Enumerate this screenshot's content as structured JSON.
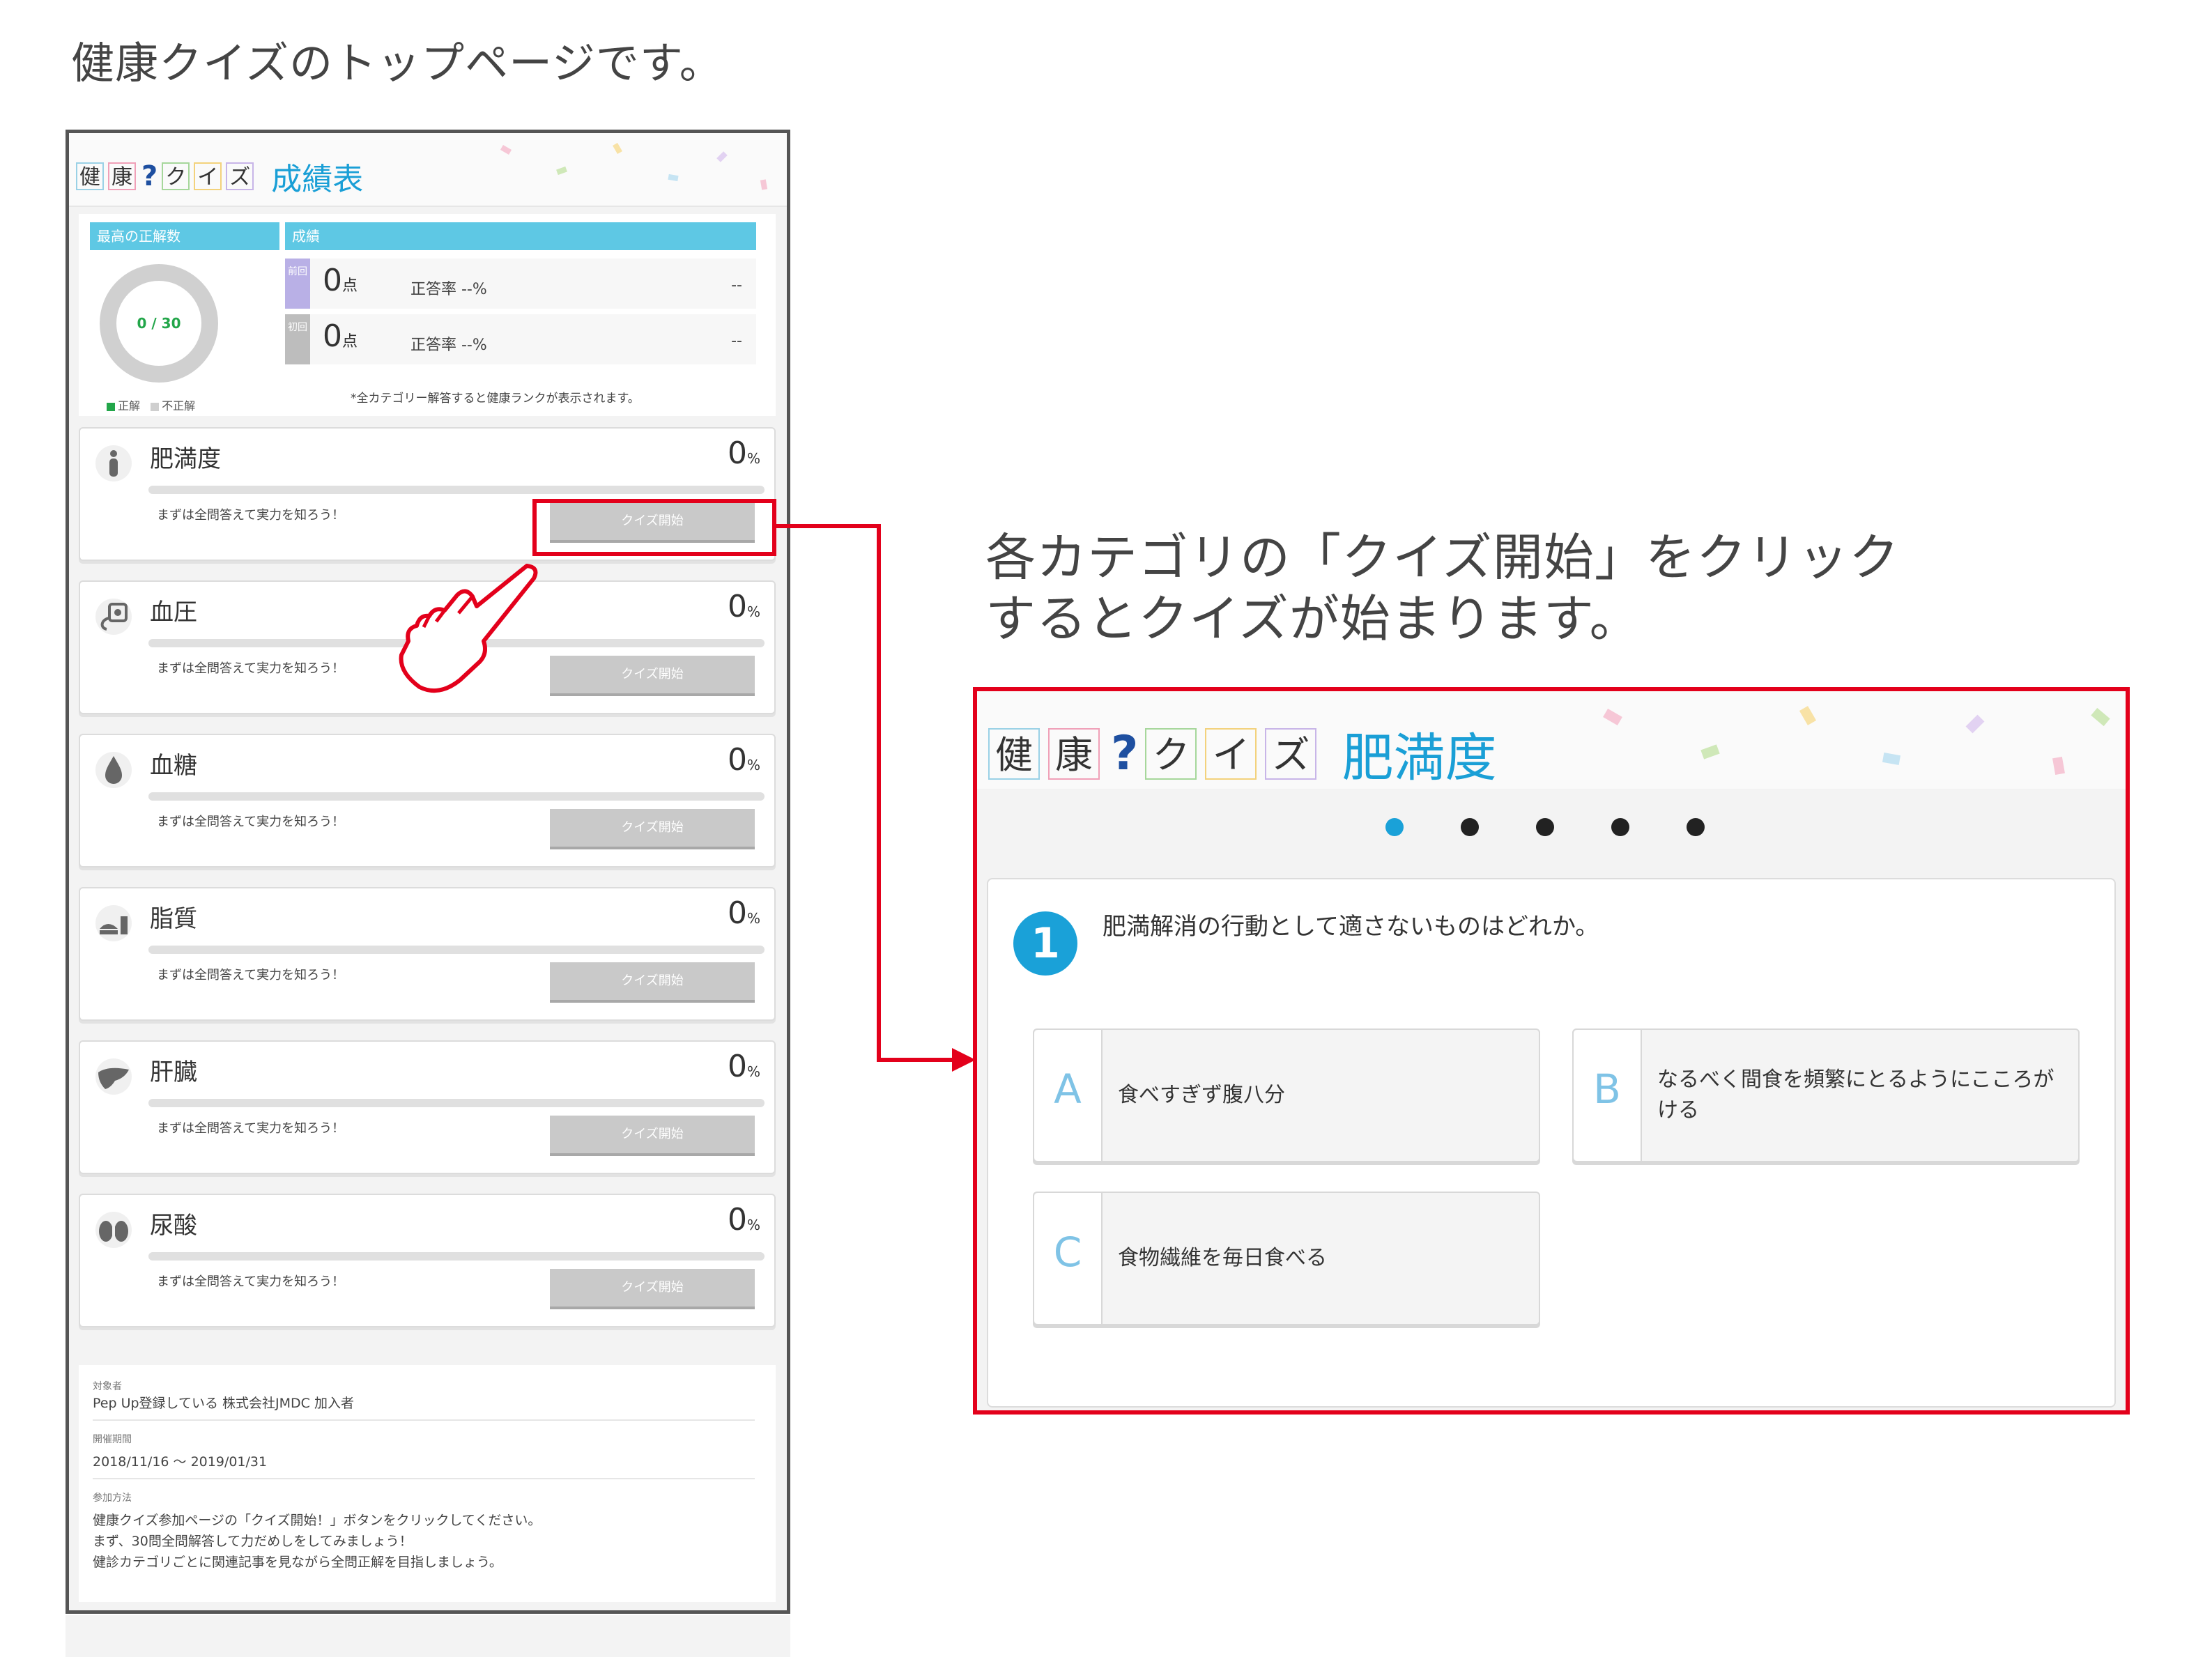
{
  "captions": {
    "top": "健康クイズのトップページです。",
    "right_line1": "各カテゴリの「クイズ開始」をクリック",
    "right_line2": "するとクイズが始まります。"
  },
  "logo": {
    "chars": [
      "健",
      "康",
      "?",
      "ク",
      "イ",
      "ズ"
    ]
  },
  "top_page": {
    "title": "成績表",
    "summary": {
      "best_label": "最高の正解数",
      "score_label": "成績",
      "donut_text": "0 / 30",
      "legend_correct": "正解",
      "legend_incorrect": "不正解",
      "rows": [
        {
          "tag": "前回",
          "score": "0",
          "unit": "点",
          "rate": "正答率 --%",
          "right": "--"
        },
        {
          "tag": "初回",
          "score": "0",
          "unit": "点",
          "rate": "正答率 --%",
          "right": "--"
        }
      ],
      "note": "*全カテゴリー解答すると健康ランクが表示されます。"
    },
    "categories": [
      {
        "name": "肥満度",
        "pct": "0",
        "unit": "%",
        "msg": "まずは全問答えて実力を知ろう！",
        "button": "クイズ開始",
        "icon": "body-icon"
      },
      {
        "name": "血圧",
        "pct": "0",
        "unit": "%",
        "msg": "まずは全問答えて実力を知ろう！",
        "button": "クイズ開始",
        "icon": "blood-pressure-icon"
      },
      {
        "name": "血糖",
        "pct": "0",
        "unit": "%",
        "msg": "まずは全問答えて実力を知ろう！",
        "button": "クイズ開始",
        "icon": "drop-icon"
      },
      {
        "name": "脂質",
        "pct": "0",
        "unit": "%",
        "msg": "まずは全問答えて実力を知ろう！",
        "button": "クイズ開始",
        "icon": "food-icon"
      },
      {
        "name": "肝臓",
        "pct": "0",
        "unit": "%",
        "msg": "まずは全問答えて実力を知ろう！",
        "button": "クイズ開始",
        "icon": "liver-icon"
      },
      {
        "name": "尿酸",
        "pct": "0",
        "unit": "%",
        "msg": "まずは全問答えて実力を知ろう！",
        "button": "クイズ開始",
        "icon": "kidney-icon"
      }
    ],
    "info": {
      "target_label": "対象者",
      "target_value": "Pep Up登録している 株式会社JMDC 加入者",
      "period_label": "開催期間",
      "period_value": "2018/11/16 ～ 2019/01/31",
      "method_label": "参加方法",
      "method_line1": "健康クイズ参加ページの「クイズ開始！」ボタンをクリックしてください。",
      "method_line2": "まず、30問全問解答して力だめしをしてみましょう！",
      "method_line3": "健診カテゴリごとに関連記事を見ながら全問正解を目指しましょう。"
    }
  },
  "quiz_page": {
    "title": "肥満度",
    "progress": {
      "total": 5,
      "current": 1
    },
    "question_number": "1",
    "question": "肥満解消の行動として適さないものはどれか。",
    "options": [
      {
        "letter": "A",
        "text": "食べすぎず腹八分"
      },
      {
        "letter": "B",
        "text": "なるべく間食を頻繁にとるようにこころがける"
      },
      {
        "letter": "C",
        "text": "食物繊維を毎日食べる"
      }
    ]
  },
  "colors": {
    "accent_blue": "#1aa1d8",
    "header_bar": "#5ec8e4",
    "highlight_red": "#e3001b",
    "button_gray": "#c9c9c9"
  }
}
